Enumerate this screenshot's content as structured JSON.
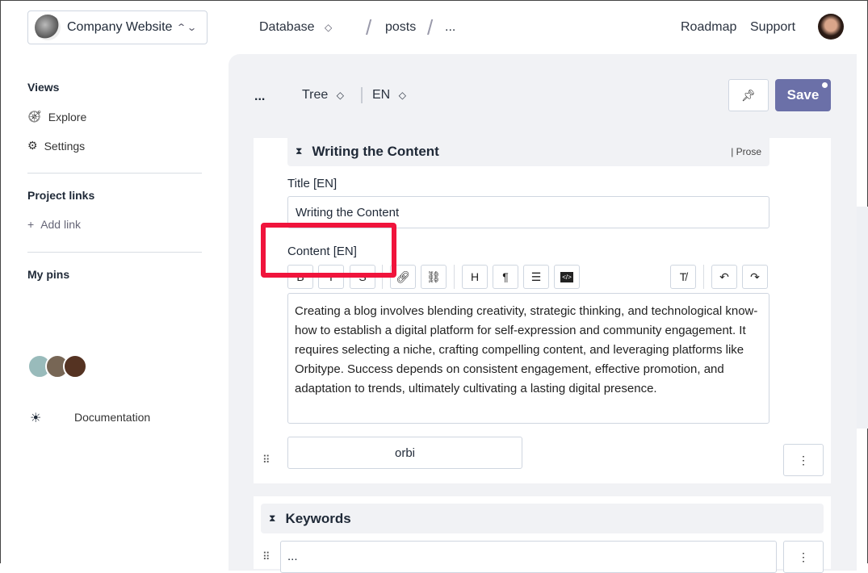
{
  "header": {
    "project": "Company Website",
    "nav": [
      "Database",
      "posts",
      "..."
    ],
    "links": [
      "Roadmap",
      "Support"
    ]
  },
  "sidebar": {
    "views_title": "Views",
    "views": [
      "Explore",
      "Settings"
    ],
    "links_title": "Project links",
    "add_link": "Add link",
    "pins_title": "My pins",
    "documentation": "Documentation"
  },
  "toolbar": {
    "more": "...",
    "view": "Tree",
    "lang": "EN",
    "save": "Save"
  },
  "block": {
    "title": "Writing the Content",
    "type": "| Prose",
    "title_label": "Title [EN]",
    "title_value": "Writing the Content",
    "content_label": "Content [EN]",
    "content": "Creating a blog involves blending creativity, strategic thinking, and technological know-how to establish a digital platform for self-expression and community engagement. It requires selecting a niche, crafting compelling content, and leveraging platforms like Orbitype. Success depends on consistent engagement, effective promotion, and adaptation to trends, ultimately cultivating a lasting digital presence.",
    "tag": "orbi"
  },
  "keywords": {
    "title": "Keywords",
    "value": "..."
  },
  "editor_buttons": [
    "B",
    "I",
    "S",
    "link",
    "unlink",
    "H",
    "¶",
    "list",
    "code",
    "clear",
    "undo",
    "redo"
  ],
  "colors": {
    "accent": "#6b70a8",
    "highlight": "#f0143c"
  }
}
